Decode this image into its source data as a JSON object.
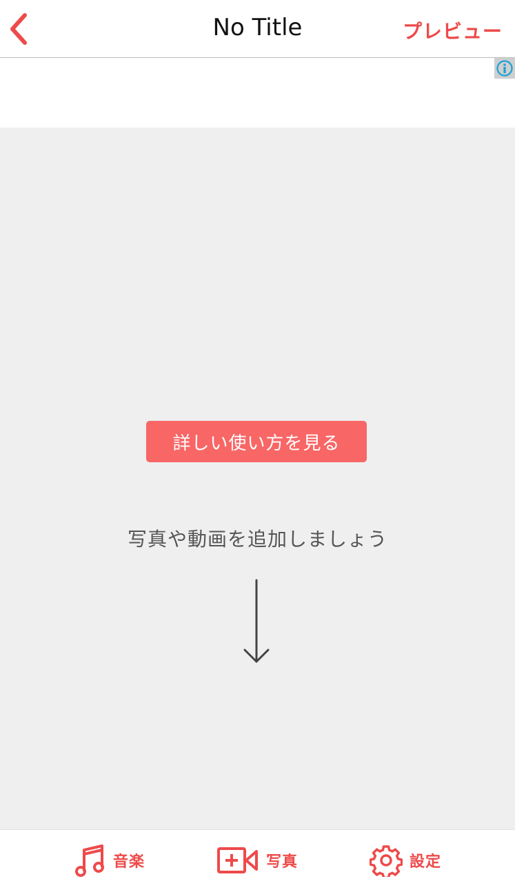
{
  "nav": {
    "title": "No Title",
    "preview_label": "プレビュー"
  },
  "ad": {
    "info_icon": "info-icon"
  },
  "main": {
    "howto_button_label": "詳しい使い方を見る",
    "hint_text": "写真や動画を追加しましょう",
    "arrow_icon": "down-arrow-icon"
  },
  "tabbar": {
    "tabs": [
      {
        "label": "音楽",
        "icon": "music-note-icon"
      },
      {
        "label": "写真",
        "icon": "add-media-icon"
      },
      {
        "label": "設定",
        "icon": "gear-icon"
      }
    ]
  },
  "colors": {
    "accent": "#ee4a4a",
    "button_bg": "#f86666",
    "content_bg": "#efefef",
    "ad_info": "#1ba1d8"
  }
}
